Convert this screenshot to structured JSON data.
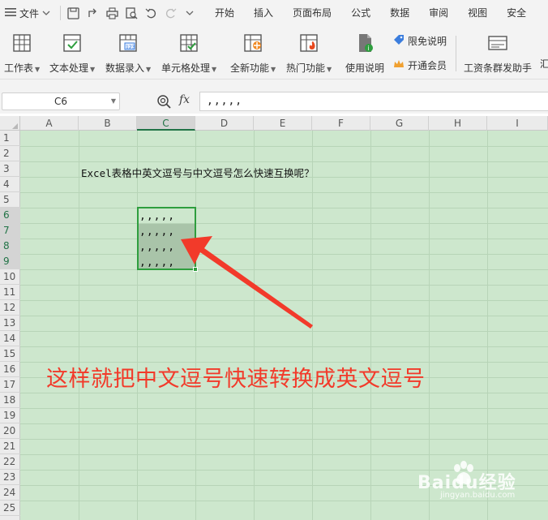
{
  "menu": {
    "file_label": "文件",
    "tabs": [
      "开始",
      "插入",
      "页面布局",
      "公式",
      "数据",
      "审阅",
      "视图",
      "安全"
    ]
  },
  "ribbon": {
    "buttons": [
      {
        "label": "工作表",
        "icon": "worksheet-icon"
      },
      {
        "label": "文本处理",
        "icon": "text-process-icon"
      },
      {
        "label": "数据录入",
        "icon": "data-entry-icon"
      },
      {
        "label": "单元格处理",
        "icon": "cell-process-icon"
      },
      {
        "label": "全新功能",
        "icon": "new-feature-icon"
      },
      {
        "label": "热门功能",
        "icon": "hot-feature-icon"
      },
      {
        "label": "使用说明",
        "icon": "help-doc-icon"
      }
    ],
    "free_note": "限免说明",
    "vip": "开通会员",
    "payroll": "工资条群发助手",
    "more": "汇"
  },
  "formula_bar": {
    "name_box": "C6",
    "fx": "fx",
    "value": ",,,,,"
  },
  "columns": [
    "A",
    "B",
    "C",
    "D",
    "E",
    "F",
    "G",
    "H",
    "I"
  ],
  "rows": [
    "1",
    "2",
    "3",
    "4",
    "5",
    "6",
    "7",
    "8",
    "9",
    "10",
    "11",
    "12",
    "13",
    "14",
    "15",
    "16",
    "17",
    "18",
    "19",
    "20",
    "21",
    "22",
    "23",
    "24",
    "25"
  ],
  "cells": {
    "b3": "Excel表格中英文逗号与中文逗号怎么快速互换呢？",
    "c6": ",,,,,",
    "c7": ",,,,,",
    "c8": ",,,,,",
    "c9": ",,,,,"
  },
  "annotation": "这样就把中文逗号快速转换成英文逗号",
  "watermark": {
    "brand": "Baidu经验",
    "url": "jingyan.baidu.com"
  },
  "colors": {
    "grid_bg": "#cde7cd",
    "selection": "#2e9e3e",
    "annotation": "#f23a2a"
  }
}
